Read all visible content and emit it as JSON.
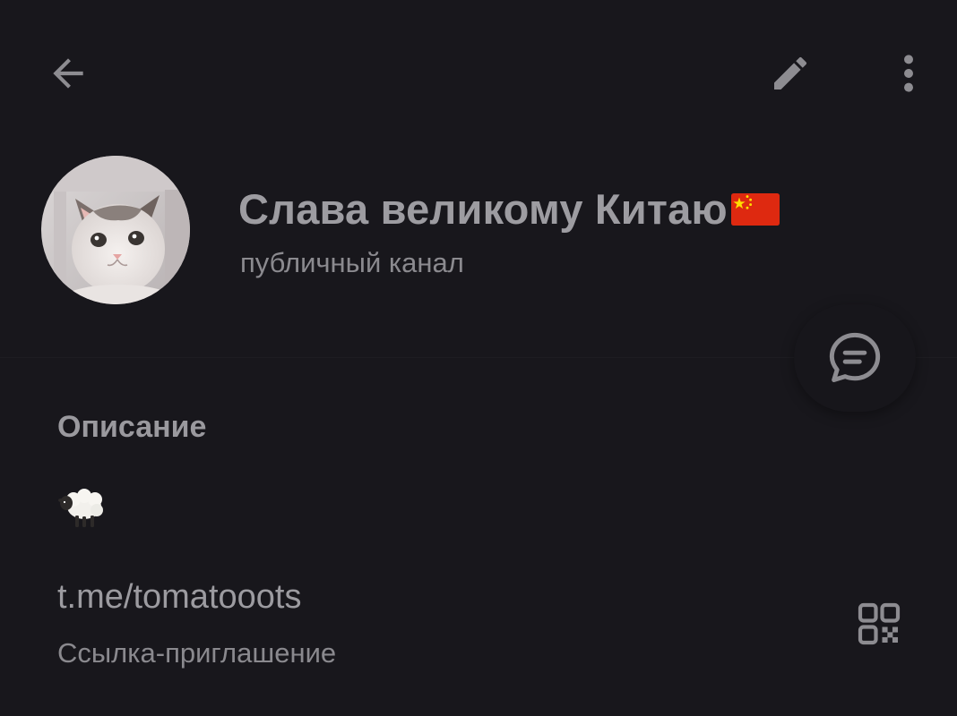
{
  "toolbar": {
    "back_icon": "arrow-left-icon",
    "edit_icon": "pencil-icon",
    "more_icon": "more-vertical-icon"
  },
  "channel": {
    "title": "Слава великому Китаю",
    "flag": "china-flag",
    "subtitle": "публичный канал",
    "avatar": "cat-photo"
  },
  "comment_button": {
    "icon": "comment-icon"
  },
  "description": {
    "label": "Описание",
    "content_icon": "sheep-emoji"
  },
  "link": {
    "url": "t.me/tomatooots",
    "caption": "Ссылка-приглашение",
    "qr_icon": "qr-code-icon"
  },
  "colors": {
    "background": "#18171c",
    "text_primary": "#9d9ca1",
    "text_secondary": "#8b8a8f",
    "icon": "#8d8c91"
  }
}
